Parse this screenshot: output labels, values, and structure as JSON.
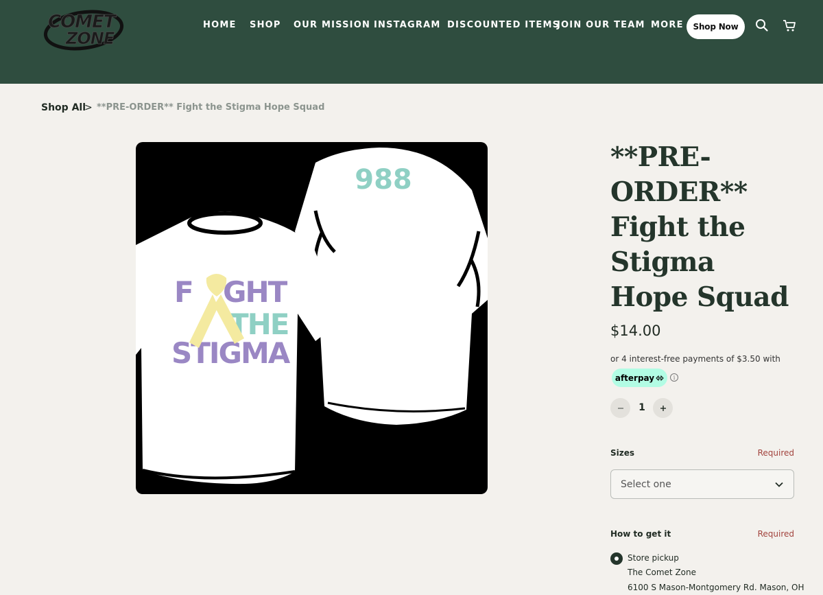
{
  "brand": {
    "logo_text_line1": "COMET",
    "logo_text_line2": "ZONE"
  },
  "nav": {
    "items": [
      {
        "label": "HOME"
      },
      {
        "label": "SHOP"
      },
      {
        "label": "OUR MISSION"
      },
      {
        "label": "INSTAGRAM"
      },
      {
        "label": "DISCOUNTED ITEMS"
      },
      {
        "label": "JOIN OUR TEAM"
      },
      {
        "label": "MORE"
      }
    ],
    "cta_label": "Shop Now",
    "icons": [
      "search-icon",
      "cart-icon"
    ]
  },
  "breadcrumb": {
    "home": "Shop All",
    "separator": ">",
    "current": "**PRE-ORDER** Fight the Stigma Hope Squad"
  },
  "product": {
    "image": {
      "shirt_front_line1_a": "F",
      "shirt_front_line1_b": "GHT",
      "shirt_front_line2": "THE",
      "shirt_front_line3": "STIGMA",
      "shirt_back_text": "988",
      "colors": {
        "purple": "#9a87c4",
        "teal": "#8fd0c4",
        "yellow": "#f4eaa0"
      }
    },
    "title": "**PRE-ORDER** Fight the Stigma Hope Squad",
    "price": "$14.00",
    "afterpay_text": "or 4 interest-free payments of $3.50 with",
    "afterpay_badge": "afterpay",
    "quantity": "1",
    "sizes_label": "Sizes",
    "sizes_required": "Required",
    "sizes_placeholder": "Select one",
    "fulfillment_label": "How to get it",
    "fulfillment_required": "Required",
    "pickup": {
      "option": "Store pickup",
      "store_name": "The Comet Zone",
      "address": "6100 S Mason-Montgomery Rd. Mason, OH"
    }
  },
  "colors": {
    "header_bg": "#2f4d3f",
    "page_bg": "#f3f1ed",
    "title_text": "#24352b",
    "required_text": "#a2433d",
    "afterpay_mint": "#b2fce4"
  }
}
